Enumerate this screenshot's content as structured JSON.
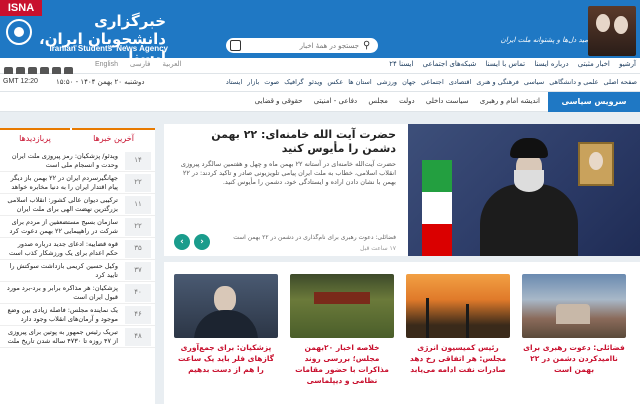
{
  "header": {
    "isna_tag": "ISNA",
    "logo_fa": "خبرگزاری دانشجویان ایران، ایسنا",
    "logo_en": "Iranian Students' News Agency",
    "search_placeholder": "جستجو در همهٔ اخبار",
    "tagline": "امید دل‌ها و پشتوانه ملت ایران"
  },
  "utility": {
    "languages": [
      "English",
      "العربية",
      "فارسی"
    ],
    "links": [
      "آرشیو",
      "اخبار مثبتی",
      "درباره ایسنا",
      "تماس با ایسنا",
      "شبکه‌های اجتماعی",
      "ایسنا ۲۴"
    ]
  },
  "nav": {
    "gmt": "GMT 12:20",
    "date": "دوشنبه ۲۰ بهمن ۱۴۰۴ - ۱۵:۵۰",
    "categories": [
      "صفحه اصلی",
      "علمی و دانشگاهی",
      "سیاسی",
      "فرهنگی و هنری",
      "اقتصادی",
      "اجتماعی",
      "جهان",
      "ورزشی",
      "استان ها",
      "عکس",
      "ویدئو",
      "گرافیک",
      "صوت",
      "بازار",
      "ایستاد"
    ]
  },
  "section": {
    "badge": "سرویس سیاسی",
    "items": [
      "اندیشه امام و رهبری",
      "سیاست داخلی",
      "دولت",
      "مجلس",
      "دفاعی - امنیتی",
      "حقوقی و قضایی"
    ]
  },
  "sidebar": {
    "tab_latest": "آخرین خبرها",
    "tab_popular": "پربازدیدها",
    "items": [
      {
        "text": "ویدئو/ پزشکیان: رمز پیروزی ملت ایران وحدت و انسجام ملی است",
        "num": "۱۴"
      },
      {
        "text": "جهانگیرسردم ایران در ۲۲ بهمن باز دیگر پیام اقتدار ایران را به دنیا مخابره خواهد کرد",
        "num": "۲۲"
      },
      {
        "text": "ترکیبی دیوان عالی کشور: انقلاب اسلامی بزرگترین نهضت الهی برای ملت ایران است",
        "num": "۱۱"
      },
      {
        "text": "سازمان بسیج مستضعفین از مردم برای شرکت در راهپیمایی ۲۲ بهمن دعوت کرد",
        "num": "۲۲"
      },
      {
        "text": "قوه قضاییه: ادعای جدید درباره صدور حکم اعدام برای یک ورزشکار کذب است",
        "num": "۳۵"
      },
      {
        "text": "وکیل حسین کریمی بازداشت سوکتش را تایید کرد",
        "num": "۳۷"
      },
      {
        "text": "پزشکیان: هر مذاکره برابر و برد-برد مورد قبول ایران است",
        "num": "۴۰"
      },
      {
        "text": "یک نماینده مجلس: فاصله زیادی بین وضع موجود و آرمان‌های انقلاب وجود دارد",
        "num": "۴۶"
      },
      {
        "text": "تبریک رئیس جمهور به پوتین برای پیروزی از ۴۷ روزه تا ۴۷۳۰ ساله شدن تاریخ ملت",
        "num": "۴۸"
      }
    ]
  },
  "featured": {
    "title": "حضرت آیت الله خامنه‌ای: ۲۲ بهمن دشمن را مأیوس کنید",
    "text": "حضرت آیت‌الله خامنه‌ای در آستانه ۲۲ بهمن ماه و چهل و هفتمین سالگرد پیروزی انقلاب اسلامی، خطاب به ملت ایران پیامی تلویزیونی صادر و تاکید کردند: در ۲۲ بهمن با نشان دادن اراده و ایستادگی خود، دشمن را مأیوس کنید.",
    "caption": "فضائلی: دعوت رهبری برای نام‌گذاری در دشمن در ۲۲ بهمن است",
    "time": "۱۷ ساعت قبل"
  },
  "cards": [
    {
      "title": "پزشکیان: برای جمع‌آوری گازهای فلر باید یک ساعت را هم از دست بدهیم"
    },
    {
      "title": "خلاصه اخبار ۲۰بهمن مجلس؛ بررسی روند مذاکرات با حضور مقامات نظامی و دیپلماسی"
    },
    {
      "title": "رئیس کمیسیون انرژی مجلس: هر اتفاقی رخ دهد صادرات نفت ادامه می‌یابد"
    },
    {
      "title": "فضائلی: دعوت رهبری برای ناامیدکردن دشمن در ۲۲ بهمن است"
    }
  ]
}
